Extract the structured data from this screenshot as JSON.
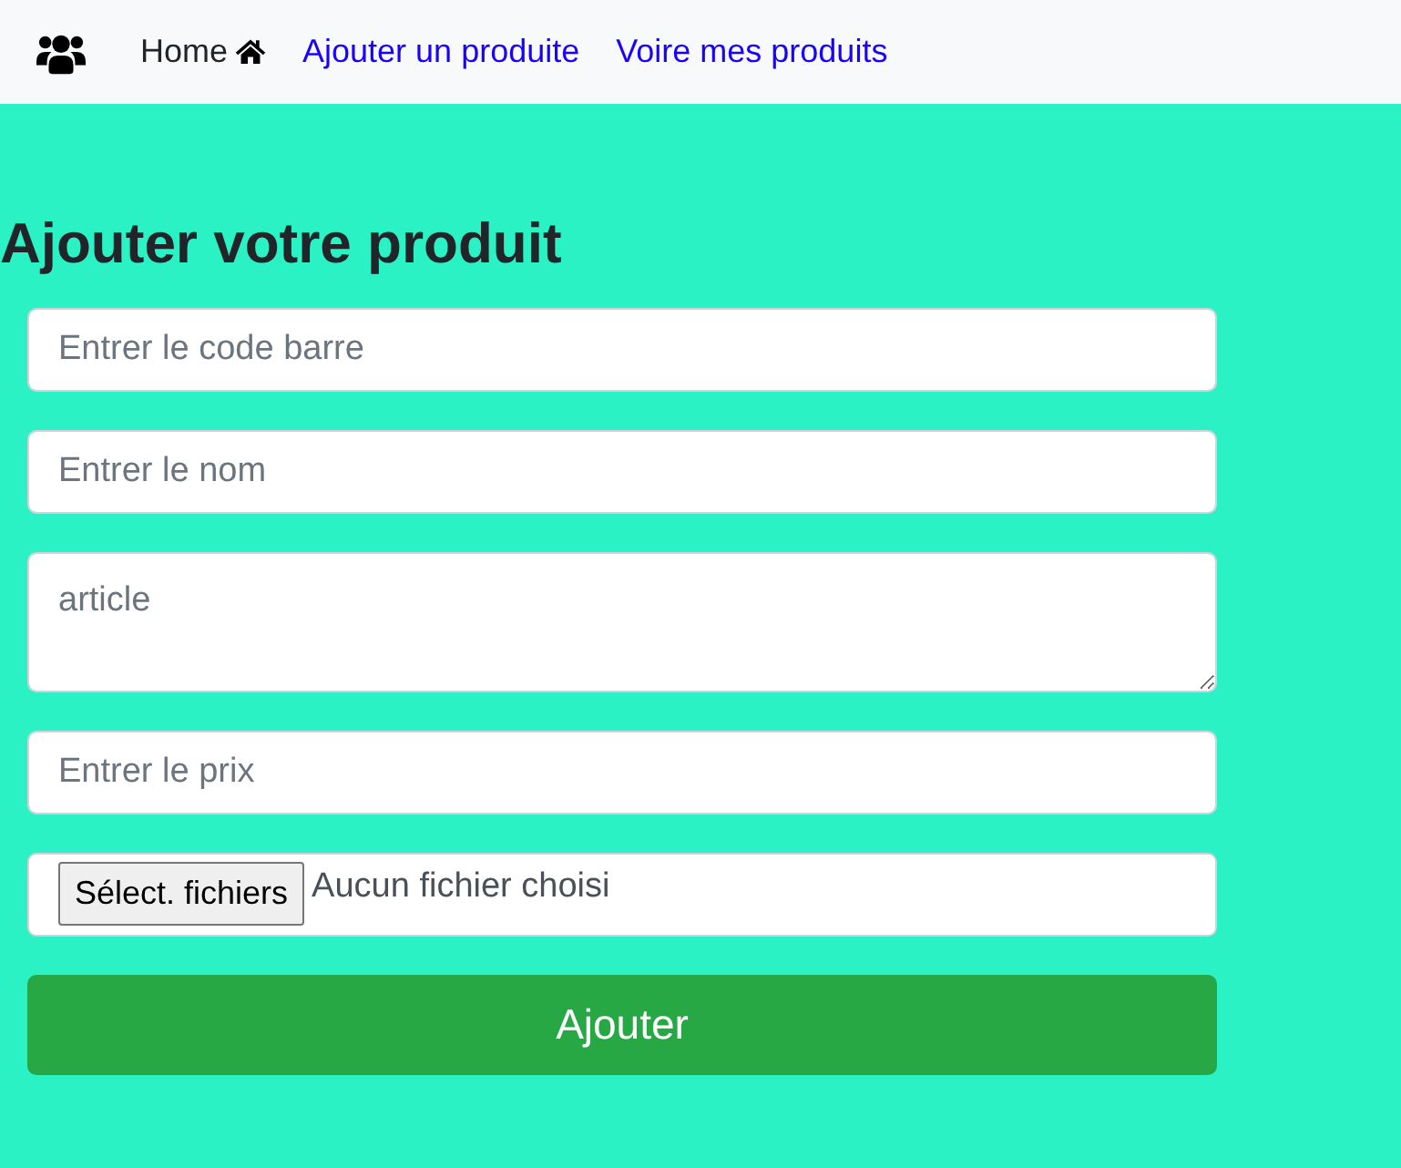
{
  "navbar": {
    "links": [
      {
        "label": "Home",
        "kind": "home"
      },
      {
        "label": "Ajouter un produite",
        "kind": "link"
      },
      {
        "label": "Voire mes produits",
        "kind": "link"
      }
    ]
  },
  "title": "Ajouter votre produit",
  "form": {
    "fields": [
      {
        "kind": "text",
        "placeholder": "Entrer le code barre"
      },
      {
        "kind": "text",
        "placeholder": "Entrer le nom"
      },
      {
        "kind": "textarea",
        "placeholder": "article"
      },
      {
        "kind": "text",
        "placeholder": "Entrer le prix"
      },
      {
        "kind": "file",
        "button_label": "Sélect. fichiers",
        "status": "Aucun fichier choisi"
      }
    ],
    "submit": {
      "label": "Ajouter"
    }
  }
}
